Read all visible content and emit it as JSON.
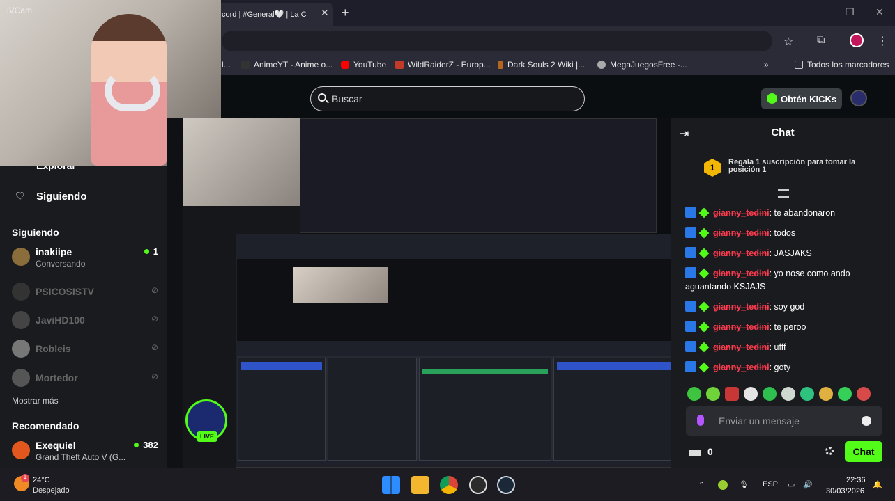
{
  "browser": {
    "tab_title": "cord | #General🤍 | La C",
    "bookmarks": [
      {
        "label": "l..."
      },
      {
        "label": "AnimeYT - Anime o..."
      },
      {
        "label": "YouTube"
      },
      {
        "label": "WildRaiderZ - Europ..."
      },
      {
        "label": "Dark Souls 2 Wiki |..."
      },
      {
        "label": "MegaJuegosFree -..."
      }
    ],
    "bookmarks_overflow": "»",
    "all_bookmarks": "Todos los marcadores"
  },
  "webcam": {
    "label": "iVCam"
  },
  "kick": {
    "search_placeholder": "Buscar",
    "get_kicks": "Obtén KICKs"
  },
  "sidebar": {
    "explore": "Explorar",
    "following_nav": "Siguiendo",
    "following_header": "Siguiendo",
    "channels": [
      {
        "name": "inakiipe",
        "status": "Conversando",
        "viewers": "1",
        "live": true
      },
      {
        "name": "PSICOSISTV",
        "live": false
      },
      {
        "name": "JaviHD100",
        "live": false
      },
      {
        "name": "Robleis",
        "live": false
      },
      {
        "name": "Mortedor",
        "live": false
      }
    ],
    "show_more": "Mostrar más",
    "recommended_header": "Recomendado",
    "recommended": {
      "name": "Exequiel",
      "category": "Grand Theft Auto V (G...",
      "viewers": "382"
    }
  },
  "stream": {
    "live_badge": "LIVE"
  },
  "chat": {
    "title": "Chat",
    "gift_rank": "1",
    "gift_text": "Regala 1 suscripción para tomar la posición 1",
    "messages": [
      {
        "user": "gianny_tedini",
        "text": ": te abandonaron"
      },
      {
        "user": "gianny_tedini",
        "text": ": todos"
      },
      {
        "user": "gianny_tedini",
        "text": ": JASJAKS"
      },
      {
        "user": "gianny_tedini",
        "text": ": yo nose como ando aguantando KSJAJS"
      },
      {
        "user": "gianny_tedini",
        "text": ": soy god"
      },
      {
        "user": "gianny_tedini",
        "text": ": te peroo"
      },
      {
        "user": "gianny_tedini",
        "text": ": ufff"
      },
      {
        "user": "gianny_tedini",
        "text": ": goty"
      }
    ],
    "input_placeholder": "Enviar un mensaje",
    "kicks_balance": "0",
    "send_label": "Chat"
  },
  "taskbar": {
    "weather_temp": "24°C",
    "weather_desc": "Despejado",
    "weather_badge": "1",
    "lang": "ESP",
    "time": "22:36",
    "date": "30/03/2026"
  },
  "colors": {
    "kick_green": "#53fc18",
    "chat_user": "#ff3b4e",
    "badge_blue": "#2a77e8"
  }
}
